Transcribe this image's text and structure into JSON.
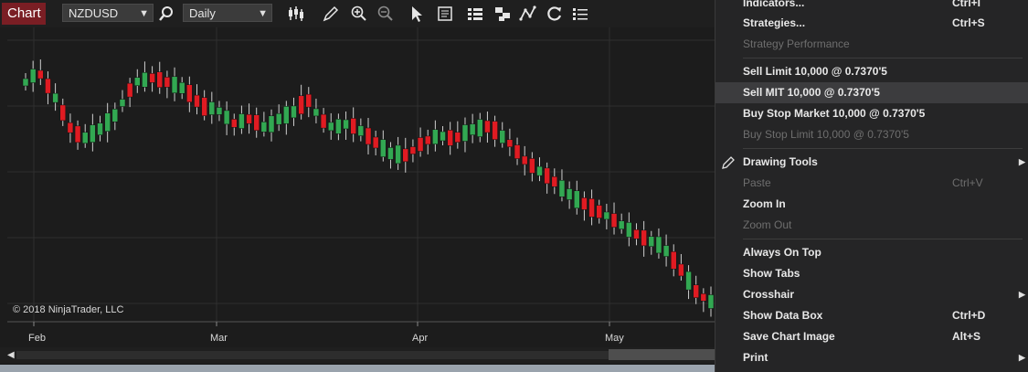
{
  "toolbar": {
    "tab_label": "Chart",
    "instrument": "NZDUSD",
    "period": "Daily",
    "icons": [
      "search-icon",
      "bar-type-icon",
      "draw-pencil-icon",
      "zoom-in-icon",
      "zoom-out-icon",
      "pointer-icon",
      "data-box-icon",
      "chart-trader-icon",
      "properties-icon",
      "strategies-icon",
      "reload-icon",
      "list-icon"
    ]
  },
  "chart": {
    "copyright": "© 2018 NinjaTrader, LLC",
    "x_labels": [
      "Feb",
      "Mar",
      "Apr",
      "May"
    ],
    "bull_color": "#32a852",
    "bear_color": "#e01b22"
  },
  "chart_data": {
    "type": "candlestick",
    "instrument": "NZDUSD",
    "period": "Daily",
    "x_labels": [
      "Feb",
      "Mar",
      "Apr",
      "May"
    ],
    "candles_direction": [
      "up",
      "up",
      "down",
      "down",
      "up",
      "down",
      "down",
      "down",
      "up",
      "up",
      "up",
      "up",
      "up",
      "up",
      "down",
      "up",
      "up",
      "down",
      "down",
      "down",
      "up",
      "up",
      "down",
      "down",
      "down",
      "up",
      "up",
      "up",
      "down",
      "up",
      "down",
      "down",
      "up",
      "up",
      "up",
      "up",
      "up",
      "down",
      "down",
      "up",
      "down",
      "up",
      "up",
      "up",
      "down",
      "up",
      "down",
      "down",
      "up",
      "up",
      "up",
      "down",
      "down",
      "down",
      "down",
      "up",
      "up",
      "down",
      "down",
      "up",
      "up",
      "up",
      "down",
      "down",
      "up",
      "down",
      "down",
      "down",
      "down",
      "up",
      "down",
      "down",
      "up",
      "up",
      "up",
      "down",
      "down",
      "down",
      "up",
      "down",
      "up",
      "up",
      "down",
      "down",
      "up",
      "up",
      "up",
      "down",
      "down",
      "up",
      "down",
      "down",
      "up"
    ]
  },
  "menu": {
    "items": [
      {
        "label": "Indicators...",
        "shortcut": "Ctrl+I",
        "disabled": false
      },
      {
        "label": "Strategies...",
        "shortcut": "Ctrl+S",
        "disabled": false
      },
      {
        "label": "Strategy Performance",
        "shortcut": "",
        "disabled": true
      },
      {
        "label": "Sell Limit 10,000 @ 0.7370'5",
        "shortcut": "",
        "disabled": false
      },
      {
        "label": "Sell MIT 10,000 @ 0.7370'5",
        "shortcut": "",
        "disabled": false,
        "highlighted": true
      },
      {
        "label": "Buy Stop Market 10,000 @ 0.7370'5",
        "shortcut": "",
        "disabled": false
      },
      {
        "label": "Buy Stop Limit 10,000 @ 0.7370'5",
        "shortcut": "",
        "disabled": true
      },
      {
        "label": "Drawing Tools",
        "shortcut": "",
        "disabled": false,
        "submenu": true
      },
      {
        "label": "Paste",
        "shortcut": "Ctrl+V",
        "disabled": true
      },
      {
        "label": "Zoom In",
        "shortcut": "",
        "disabled": false
      },
      {
        "label": "Zoom Out",
        "shortcut": "",
        "disabled": true
      },
      {
        "label": "Always On Top",
        "shortcut": "",
        "disabled": false
      },
      {
        "label": "Show Tabs",
        "shortcut": "",
        "disabled": false
      },
      {
        "label": "Crosshair",
        "shortcut": "",
        "disabled": false,
        "submenu": true
      },
      {
        "label": "Show Data Box",
        "shortcut": "Ctrl+D",
        "disabled": false
      },
      {
        "label": "Save Chart Image",
        "shortcut": "Alt+S",
        "disabled": false
      },
      {
        "label": "Print",
        "shortcut": "",
        "disabled": false,
        "submenu": true
      }
    ]
  }
}
